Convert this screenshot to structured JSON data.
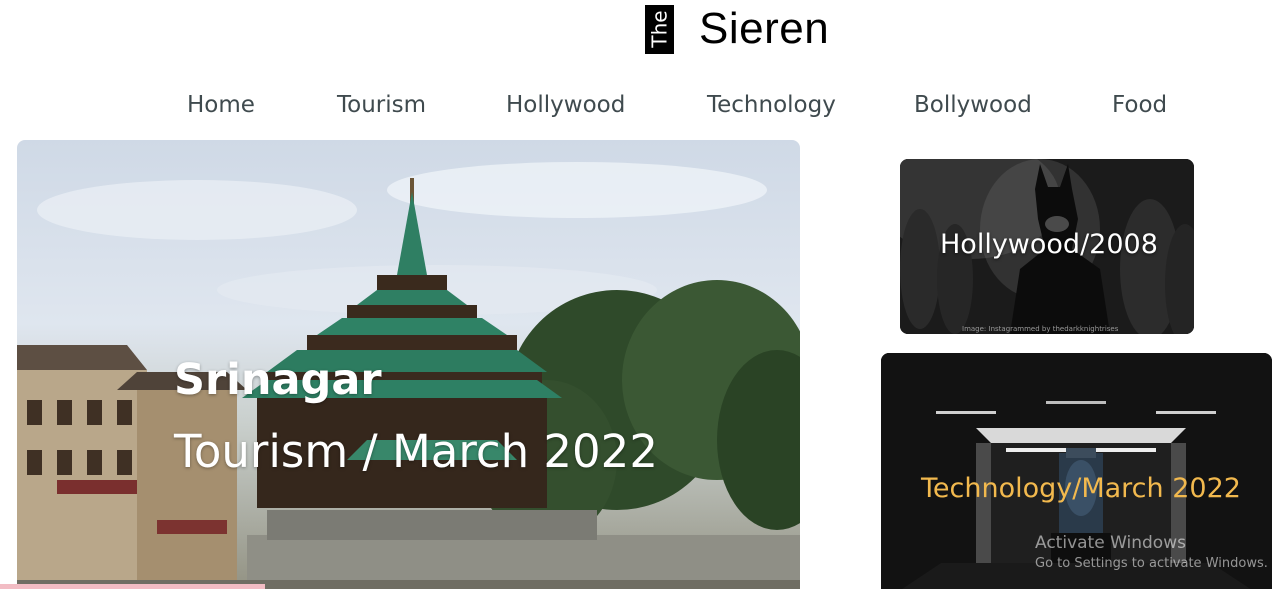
{
  "logo": {
    "prefix": "The",
    "name": "Sieren"
  },
  "nav": {
    "items": [
      {
        "label": "Home"
      },
      {
        "label": "Tourism"
      },
      {
        "label": "Hollywood"
      },
      {
        "label": "Technology"
      },
      {
        "label": "Bollywood"
      },
      {
        "label": "Food"
      }
    ]
  },
  "hero": {
    "title": "Srinagar",
    "subtitle": "Tourism / March 2022",
    "image": "srinagar-mosque-photo"
  },
  "cards": [
    {
      "caption": "Hollywood/2008",
      "credit": "Image: Instagrammed by thedarkknightrises",
      "image": "batman-photo"
    },
    {
      "caption": "Technology/March 2022",
      "image": "quantum-computer-photo",
      "caption_color": "#f2b94e"
    }
  ],
  "watermark": {
    "title": "Activate Windows",
    "subtitle": "Go to Settings to activate Windows."
  },
  "colors": {
    "nav_text": "#3f4a4e",
    "logo_box": "#000000",
    "accent_caption": "#f2b94e"
  }
}
